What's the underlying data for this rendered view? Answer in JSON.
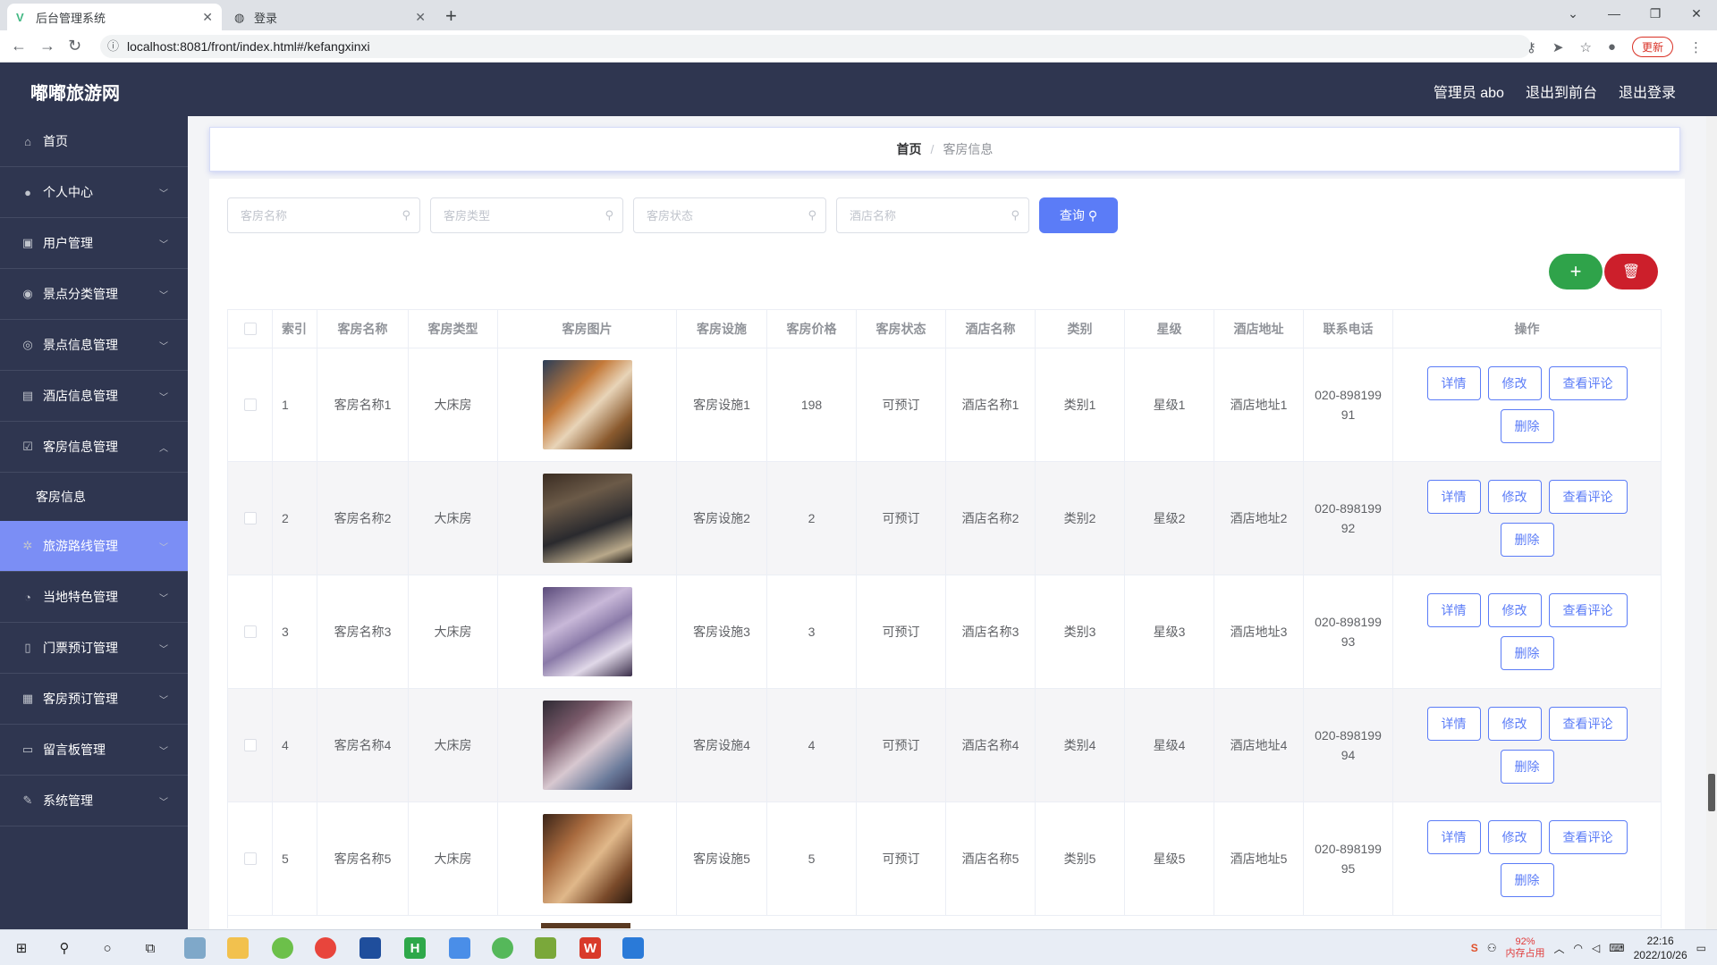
{
  "browser": {
    "tabs": [
      {
        "title": "后台管理系统",
        "active": true
      },
      {
        "title": "登录",
        "active": false
      }
    ],
    "url": "localhost:8081/front/index.html#/kefangxinxi",
    "update_label": "更新"
  },
  "header": {
    "brand": "嘟嘟旅游网",
    "links": [
      "管理员 abo",
      "退出到前台",
      "退出登录"
    ]
  },
  "sidebar": {
    "items": [
      {
        "label": "首页",
        "icon": "home-icon",
        "expandable": false
      },
      {
        "label": "个人中心",
        "icon": "user-icon",
        "expandable": true
      },
      {
        "label": "用户管理",
        "icon": "clipboard-icon",
        "expandable": true
      },
      {
        "label": "景点分类管理",
        "icon": "location-icon",
        "expandable": true
      },
      {
        "label": "景点信息管理",
        "icon": "compass-icon",
        "expandable": true
      },
      {
        "label": "酒店信息管理",
        "icon": "briefcase-icon",
        "expandable": true
      },
      {
        "label": "客房信息管理",
        "icon": "checkbox-icon",
        "expandable": true,
        "expanded": true
      },
      {
        "label": "客房信息",
        "icon": "",
        "sub": true
      },
      {
        "label": "旅游路线管理",
        "icon": "gear-icon",
        "expandable": true,
        "hover": true
      },
      {
        "label": "当地特色管理",
        "icon": "dashboard-icon",
        "expandable": true
      },
      {
        "label": "门票预订管理",
        "icon": "phone-icon",
        "expandable": true
      },
      {
        "label": "客房预订管理",
        "icon": "suitcase-icon",
        "expandable": true
      },
      {
        "label": "留言板管理",
        "icon": "message-icon",
        "expandable": true
      },
      {
        "label": "系统管理",
        "icon": "tools-icon",
        "expandable": true
      }
    ]
  },
  "breadcrumb": {
    "home": "首页",
    "separator": "/",
    "current": "客房信息"
  },
  "search": {
    "placeholders": [
      "客房名称",
      "客房类型",
      "客房状态",
      "酒店名称"
    ],
    "query_label": "查询"
  },
  "table": {
    "headers": [
      "索引",
      "客房名称",
      "客房类型",
      "客房图片",
      "客房设施",
      "客房价格",
      "客房状态",
      "酒店名称",
      "类别",
      "星级",
      "酒店地址",
      "联系电话",
      "操作"
    ],
    "rows": [
      {
        "idx": "1",
        "name": "客房名称1",
        "type": "大床房",
        "facility": "客房设施1",
        "price": "198",
        "status": "可预订",
        "hotel": "酒店名称1",
        "category": "类别1",
        "star": "星级1",
        "address": "酒店地址1",
        "phone": "020-89819991"
      },
      {
        "idx": "2",
        "name": "客房名称2",
        "type": "大床房",
        "facility": "客房设施2",
        "price": "2",
        "status": "可预订",
        "hotel": "酒店名称2",
        "category": "类别2",
        "star": "星级2",
        "address": "酒店地址2",
        "phone": "020-89819992"
      },
      {
        "idx": "3",
        "name": "客房名称3",
        "type": "大床房",
        "facility": "客房设施3",
        "price": "3",
        "status": "可预订",
        "hotel": "酒店名称3",
        "category": "类别3",
        "star": "星级3",
        "address": "酒店地址3",
        "phone": "020-89819993"
      },
      {
        "idx": "4",
        "name": "客房名称4",
        "type": "大床房",
        "facility": "客房设施4",
        "price": "4",
        "status": "可预订",
        "hotel": "酒店名称4",
        "category": "类别4",
        "star": "星级4",
        "address": "酒店地址4",
        "phone": "020-89819994"
      },
      {
        "idx": "5",
        "name": "客房名称5",
        "type": "大床房",
        "facility": "客房设施5",
        "price": "5",
        "status": "可预订",
        "hotel": "酒店名称5",
        "category": "类别5",
        "star": "星级5",
        "address": "酒店地址5",
        "phone": "020-89819995"
      }
    ],
    "ops": {
      "detail": "详情",
      "edit": "修改",
      "comments": "查看评论",
      "delete": "删除"
    }
  },
  "taskbar": {
    "memory_percent": "92%",
    "memory_label": "内存占用",
    "time": "22:16",
    "date": "2022/10/26"
  },
  "colors": {
    "header_bg": "#2f3650",
    "accent": "#5b7cf7",
    "add_button": "#2fa34a",
    "delete_button": "#cc1f2b",
    "sidebar_hover": "#7b8ef5"
  }
}
